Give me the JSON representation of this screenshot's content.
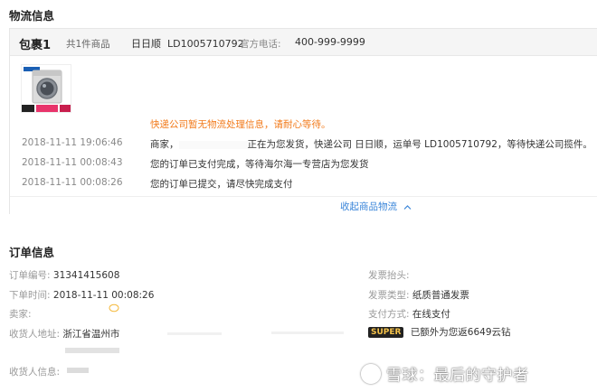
{
  "logistics": {
    "title": "物流信息",
    "package": {
      "name": "包裹1",
      "count": "共1件商品",
      "carrier": "日日顺",
      "tracking_no": "LD1005710792",
      "phone_label": "官方电话:",
      "phone": "400-999-9999"
    },
    "product_image_icon": "washing-machine-icon",
    "events": [
      {
        "time": "",
        "text": "快递公司暂无物流处理信息，请耐心等待。",
        "status": "warning"
      },
      {
        "time": "2018-11-11 19:06:46",
        "text_before": "商家，",
        "text_after": "正在为您发货，快递公司 日日顺，运单号 LD1005710792，等待快递公司揽件。"
      },
      {
        "time": "2018-11-11 00:08:43",
        "text": "您的订单已支付完成，等待海尔海一专营店为您发货"
      },
      {
        "time": "2018-11-11 00:08:26",
        "text": "您的订单已提交，请尽快完成支付"
      }
    ],
    "collapse_label": "收起商品物流",
    "collapse_icon": "chevron-up-icon"
  },
  "order": {
    "title": "订单信息",
    "left_fields": [
      {
        "label": "订单编号:",
        "value": "31341415608"
      },
      {
        "label": "下单时间:",
        "value": "2018-11-11 00:08:26"
      },
      {
        "label": "卖家:",
        "value": ""
      },
      {
        "label": "收货人地址:",
        "value": "浙江省温州市"
      },
      {
        "label": "收货人信息:",
        "value": ""
      }
    ],
    "right_fields": [
      {
        "label": "发票抬头:",
        "value": ""
      },
      {
        "label": "发票类型:",
        "value": "纸质普通发票"
      },
      {
        "label": "支付方式:",
        "value": "在线支付"
      }
    ],
    "super": {
      "badge": "SUPER",
      "text": "已额外为您返6649云钻"
    }
  },
  "watermark": {
    "text": "雪球：最后的守护者"
  },
  "colors": {
    "warning": "#f27b1c",
    "link": "#3b86d9"
  }
}
